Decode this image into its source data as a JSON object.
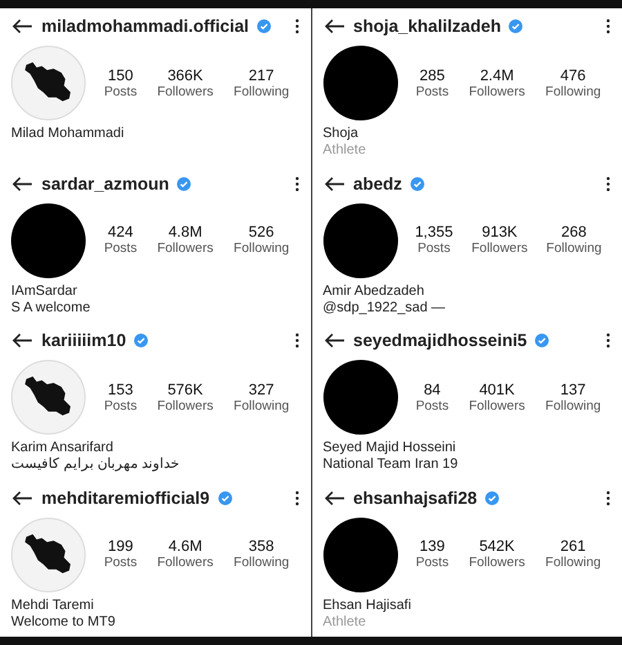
{
  "profiles": [
    {
      "username": "miladmohammadi.official",
      "verified": true,
      "kind": "map",
      "posts": "150",
      "posts_label": "Posts",
      "followers": "366K",
      "followers_label": "Followers",
      "following": "217",
      "following_label": "Following",
      "name": "Milad Mohammadi"
    },
    {
      "username": "shoja_khalilzadeh",
      "verified": true,
      "kind": "black",
      "posts": "285",
      "posts_label": "Posts",
      "followers": "2.4M",
      "followers_label": "Followers",
      "following": "476",
      "following_label": "Following",
      "name": "Shoja",
      "category": "Athlete"
    },
    {
      "username": "sardar_azmoun",
      "verified": true,
      "kind": "black",
      "posts": "424",
      "posts_label": "Posts",
      "followers": "4.8M",
      "followers_label": "Followers",
      "following": "526",
      "following_label": "Following",
      "name": "IAmSardar",
      "bio": "S A welcome"
    },
    {
      "username": "abedz",
      "verified": true,
      "kind": "black",
      "posts": "1,355",
      "posts_label": "Posts",
      "followers": "913K",
      "followers_label": "Followers",
      "following": "268",
      "following_label": "Following",
      "name": "Amir Abedzadeh",
      "bio": "@sdp_1922_sad —"
    },
    {
      "username": "kariiiiim10",
      "verified": true,
      "kind": "map",
      "posts": "153",
      "posts_label": "Posts",
      "followers": "576K",
      "followers_label": "Followers",
      "following": "327",
      "following_label": "Following",
      "name": "Karim Ansarifard",
      "bio": "خداوند مهربان برایم کافیست"
    },
    {
      "username": "seyedmajidhosseini5",
      "verified": true,
      "kind": "black",
      "posts": "84",
      "posts_label": "Posts",
      "followers": "401K",
      "followers_label": "Followers",
      "following": "137",
      "following_label": "Following",
      "name": "Seyed Majid Hosseini",
      "bio": "National Team Iran 19"
    },
    {
      "username": "mehditaremiofficial9",
      "verified": true,
      "kind": "map",
      "posts": "199",
      "posts_label": "Posts",
      "followers": "4.6M",
      "followers_label": "Followers",
      "following": "358",
      "following_label": "Following",
      "name": "Mehdi Taremi",
      "bio": "Welcome to MT9"
    },
    {
      "username": "ehsanhajsafi28",
      "verified": true,
      "kind": "black",
      "posts": "139",
      "posts_label": "Posts",
      "followers": "542K",
      "followers_label": "Followers",
      "following": "261",
      "following_label": "Following",
      "name": "Ehsan Hajisafi",
      "category": "Athlete"
    }
  ]
}
